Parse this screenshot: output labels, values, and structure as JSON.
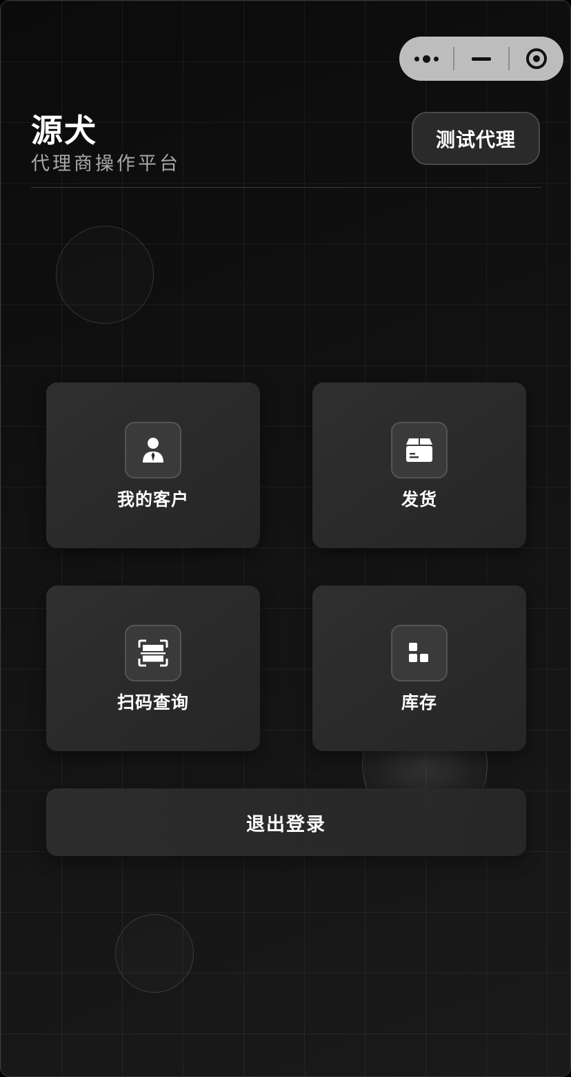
{
  "capsule": {
    "more_icon": "more-dots-icon",
    "minimize_icon": "minimize-icon",
    "close_icon": "target-close-icon"
  },
  "header": {
    "brand": "源犬",
    "subtitle": "代理商操作平台",
    "role_button": "测试代理"
  },
  "menu": {
    "items": [
      {
        "label": "我的客户",
        "icon": "customer-person-icon"
      },
      {
        "label": "发货",
        "icon": "package-box-icon"
      },
      {
        "label": "扫码查询",
        "icon": "scan-icon"
      },
      {
        "label": "库存",
        "icon": "inventory-blocks-icon"
      }
    ]
  },
  "logout": {
    "label": "退出登录"
  },
  "colors": {
    "background": "#0f0f0f",
    "tile": "#2b2b2b",
    "text": "#ffffff",
    "subtext": "#a9a9a9",
    "capsule": "#bdbdbd"
  }
}
